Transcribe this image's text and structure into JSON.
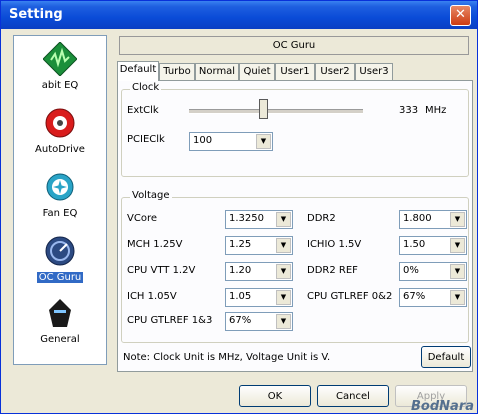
{
  "window": {
    "title": "Setting",
    "close_glyph": "✕"
  },
  "sidebar": {
    "items": [
      {
        "label": "abit EQ",
        "icon": "abit-eq-icon"
      },
      {
        "label": "AutoDrive",
        "icon": "autodrive-icon"
      },
      {
        "label": "Fan EQ",
        "icon": "fan-eq-icon"
      },
      {
        "label": "OC Guru",
        "icon": "oc-guru-icon",
        "selected": true
      },
      {
        "label": "General",
        "icon": "general-icon"
      }
    ]
  },
  "header": {
    "title": "OC Guru"
  },
  "tabs": [
    "Default",
    "Turbo",
    "Normal",
    "Quiet",
    "User1",
    "User2",
    "User3"
  ],
  "active_tab": "Default",
  "clock": {
    "group_title": "Clock",
    "extclk_label": "ExtClk",
    "extclk_value": "333",
    "extclk_unit": "MHz",
    "pcieclk_label": "PCIEClk",
    "pcieclk_value": "100"
  },
  "voltage": {
    "group_title": "Voltage",
    "rows": [
      {
        "label": "VCore",
        "value": "1.3250"
      },
      {
        "label": "MCH 1.25V",
        "value": "1.25"
      },
      {
        "label": "CPU VTT 1.2V",
        "value": "1.20"
      },
      {
        "label": "ICH 1.05V",
        "value": "1.05"
      },
      {
        "label": "CPU GTLREF 1&3",
        "value": "67%"
      },
      {
        "label": "DDR2",
        "value": "1.800"
      },
      {
        "label": "ICHIO 1.5V",
        "value": "1.50"
      },
      {
        "label": "DDR2 REF",
        "value": "0%"
      },
      {
        "label": "CPU GTLREF 0&2",
        "value": "67%"
      }
    ]
  },
  "note": "Note: Clock Unit is MHz, Voltage Unit is V.",
  "buttons": {
    "default": "Default",
    "ok": "OK",
    "cancel": "Cancel",
    "apply": "Apply"
  },
  "watermark": "BodNara",
  "colors": {
    "titlebar": "#0a4bd7",
    "selection": "#316ac5",
    "dialog_bg": "#ece9d8"
  }
}
